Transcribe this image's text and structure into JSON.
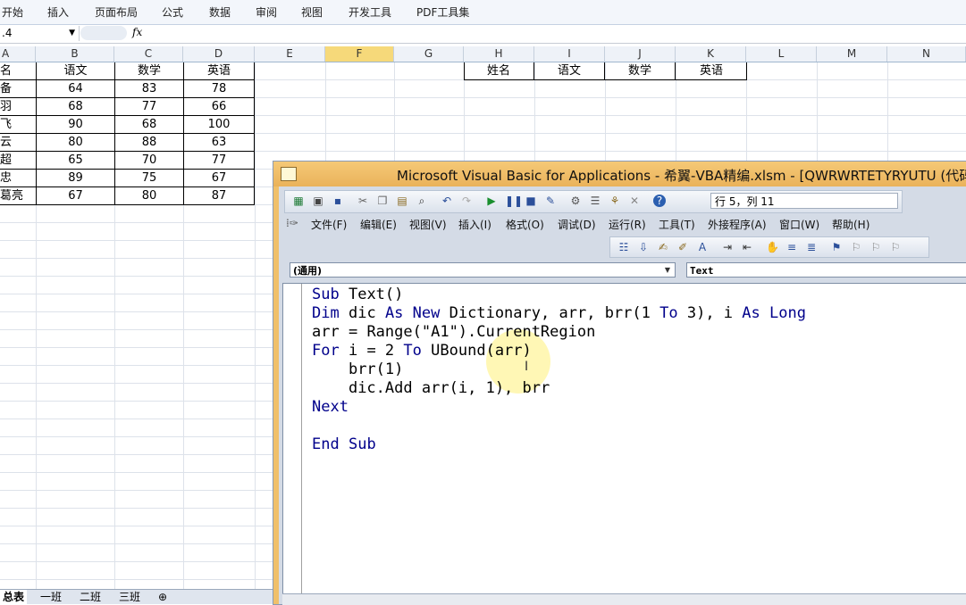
{
  "ribbon": {
    "tabs": [
      "开始",
      "插入",
      "页面布局",
      "公式",
      "数据",
      "审阅",
      "视图",
      "开发工具",
      "PDF工具集"
    ]
  },
  "formula_bar": {
    "name_box": ".4",
    "fx": "fx"
  },
  "columns": [
    "A",
    "B",
    "C",
    "D",
    "E",
    "F",
    "G",
    "H",
    "I",
    "J",
    "K",
    "L",
    "M",
    "N"
  ],
  "sheet": {
    "headers": [
      "名",
      "语文",
      "数学",
      "英语"
    ],
    "rows": [
      [
        "备",
        "64",
        "83",
        "78"
      ],
      [
        "羽",
        "68",
        "77",
        "66"
      ],
      [
        "飞",
        "90",
        "68",
        "100"
      ],
      [
        "云",
        "80",
        "88",
        "63"
      ],
      [
        "超",
        "65",
        "70",
        "77"
      ],
      [
        "忠",
        "89",
        "75",
        "67"
      ],
      [
        "葛亮",
        "67",
        "80",
        "87"
      ]
    ],
    "right_headers": [
      "姓名",
      "语文",
      "数学",
      "英语"
    ]
  },
  "sheet_tabs": [
    "总表",
    "一班",
    "二班",
    "三班"
  ],
  "vba": {
    "title": "Microsoft Visual Basic for Applications - 希翼-VBA精编.xlsm - [QWRWRTETYRYUTU (代码)]",
    "position": "行 5，列 11",
    "menus": [
      "文件(F)",
      "编辑(E)",
      "视图(V)",
      "插入(I)",
      "格式(O)",
      "调试(D)",
      "运行(R)",
      "工具(T)",
      "外接程序(A)",
      "窗口(W)",
      "帮助(H)"
    ],
    "object_combo": "(通用)",
    "proc_combo": "Text",
    "code": [
      "Sub Text()",
      "Dim dic As New Dictionary, arr, brr(1 To 3), i As Long",
      "arr = Range(\"A1\").CurrentRegion",
      "For i = 2 To UBound(arr)",
      "    brr(1)",
      "    dic.Add arr(i, 1), brr",
      "Next",
      "",
      "End Sub"
    ]
  }
}
